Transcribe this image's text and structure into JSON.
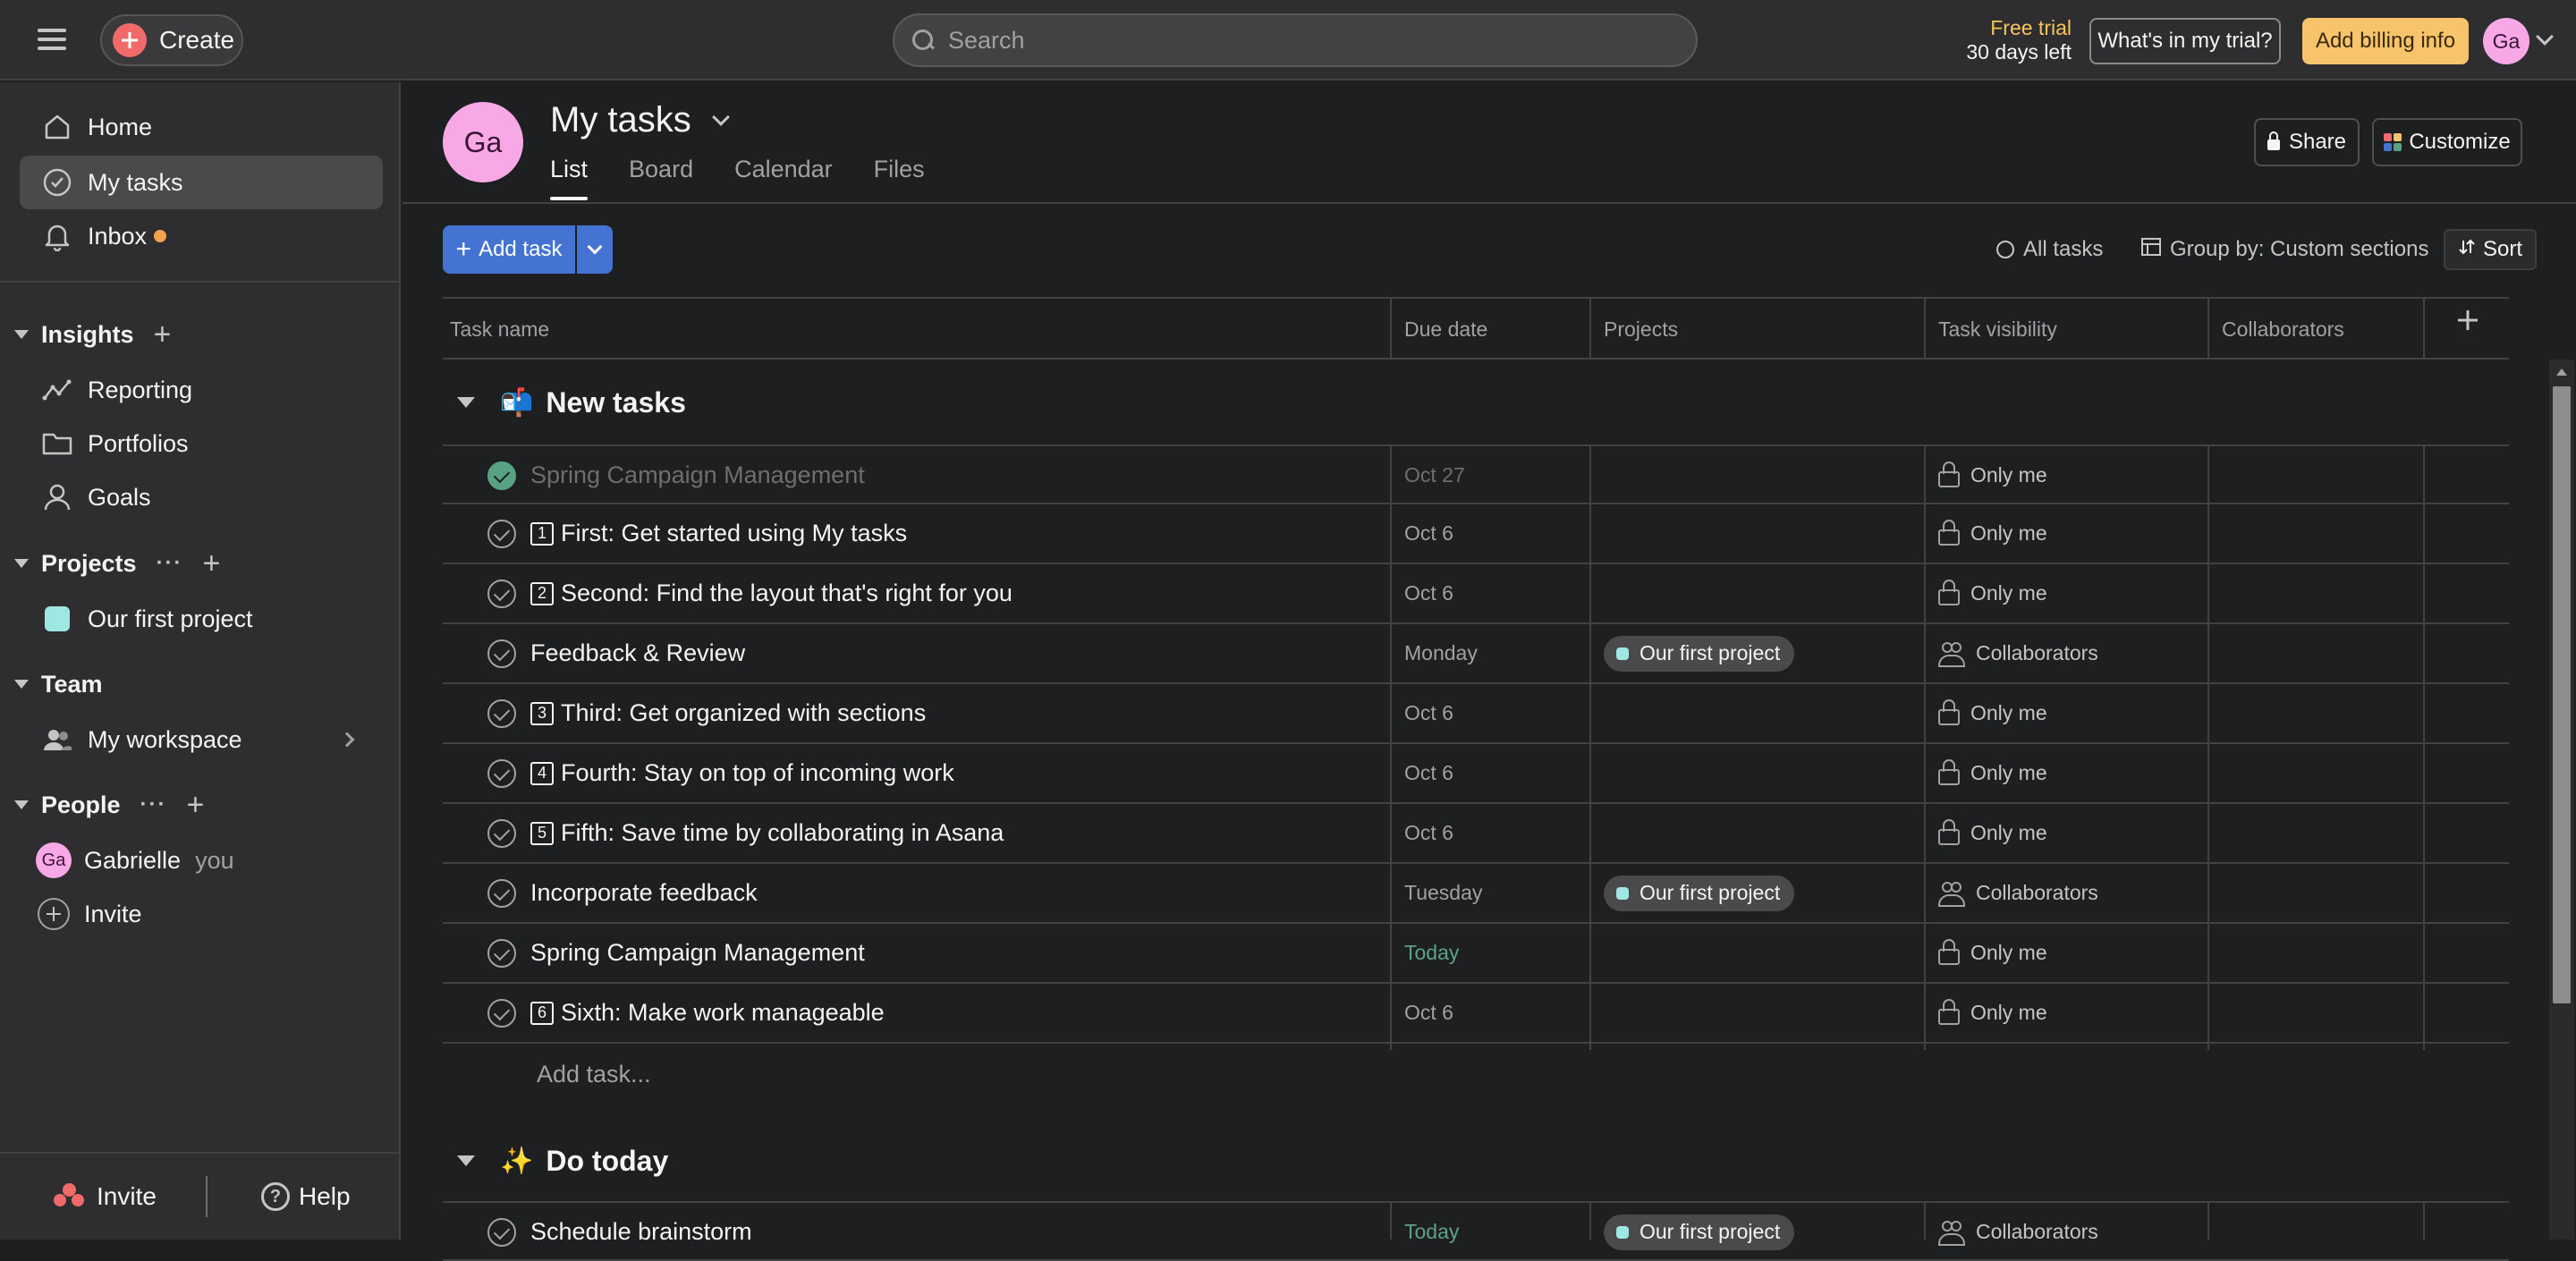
{
  "topbar": {
    "create_label": "Create",
    "search_placeholder": "Search",
    "trial_line1": "Free trial",
    "trial_line2": "30 days left",
    "trial_button": "What's in my trial?",
    "billing_button": "Add billing info",
    "avatar_initials": "Ga"
  },
  "sidebar": {
    "home": "Home",
    "my_tasks": "My tasks",
    "inbox": "Inbox",
    "insights": "Insights",
    "reporting": "Reporting",
    "portfolios": "Portfolios",
    "goals": "Goals",
    "projects": "Projects",
    "project_name": "Our first project",
    "team": "Team",
    "workspace": "My workspace",
    "people": "People",
    "person_name": "Gabrielle",
    "person_you": "you",
    "person_initials": "Ga",
    "invite": "Invite",
    "bottom_invite": "Invite",
    "bottom_help": "Help"
  },
  "header": {
    "avatar_initials": "Ga",
    "title": "My tasks",
    "tabs": [
      "List",
      "Board",
      "Calendar",
      "Files"
    ],
    "share": "Share",
    "customize": "Customize"
  },
  "toolbar": {
    "add_task": "Add task",
    "all_tasks": "All tasks",
    "group_by": "Group by: Custom sections",
    "sort": "Sort"
  },
  "table": {
    "columns": [
      "Task name",
      "Due date",
      "Projects",
      "Task visibility",
      "Collaborators"
    ],
    "sections": [
      {
        "emoji": "📬",
        "title": "New tasks",
        "rows": [
          {
            "num": "",
            "name": "Spring Campaign Management",
            "due": "Oct 27",
            "project": "",
            "visibility": "Only me"
          },
          {
            "num": "1",
            "name": "First: Get started using My tasks",
            "due": "Oct 6",
            "project": "",
            "visibility": "Only me"
          },
          {
            "num": "2",
            "name": "Second: Find the layout that's right for you",
            "due": "Oct 6",
            "project": "",
            "visibility": "Only me"
          },
          {
            "num": "",
            "name": "Feedback & Review",
            "due": "Monday",
            "project": "Our first project",
            "visibility": "Collaborators"
          },
          {
            "num": "3",
            "name": "Third: Get organized with sections",
            "due": "Oct 6",
            "project": "",
            "visibility": "Only me"
          },
          {
            "num": "4",
            "name": "Fourth: Stay on top of incoming work",
            "due": "Oct 6",
            "project": "",
            "visibility": "Only me"
          },
          {
            "num": "5",
            "name": "Fifth: Save time by collaborating in Asana",
            "due": "Oct 6",
            "project": "",
            "visibility": "Only me"
          },
          {
            "num": "",
            "name": "Incorporate feedback",
            "due": "Tuesday",
            "project": "Our first project",
            "visibility": "Collaborators"
          },
          {
            "num": "",
            "name": "Spring Campaign Management",
            "due": "Today",
            "project": "",
            "visibility": "Only me"
          },
          {
            "num": "6",
            "name": "Sixth: Make work manageable",
            "due": "Oct 6",
            "project": "",
            "visibility": "Only me"
          }
        ],
        "add_task": "Add task..."
      },
      {
        "emoji": "✨",
        "title": "Do today",
        "rows": [
          {
            "num": "",
            "name": "Schedule brainstorm",
            "due": "Today",
            "project": "Our first project",
            "visibility": "Collaborators"
          }
        ]
      }
    ]
  },
  "colors": {
    "accent_blue": "#4573d2",
    "create_red": "#f06a6a",
    "billing_yellow": "#f7c46b",
    "complete_green": "#58a182",
    "today_green": "#5da283"
  }
}
